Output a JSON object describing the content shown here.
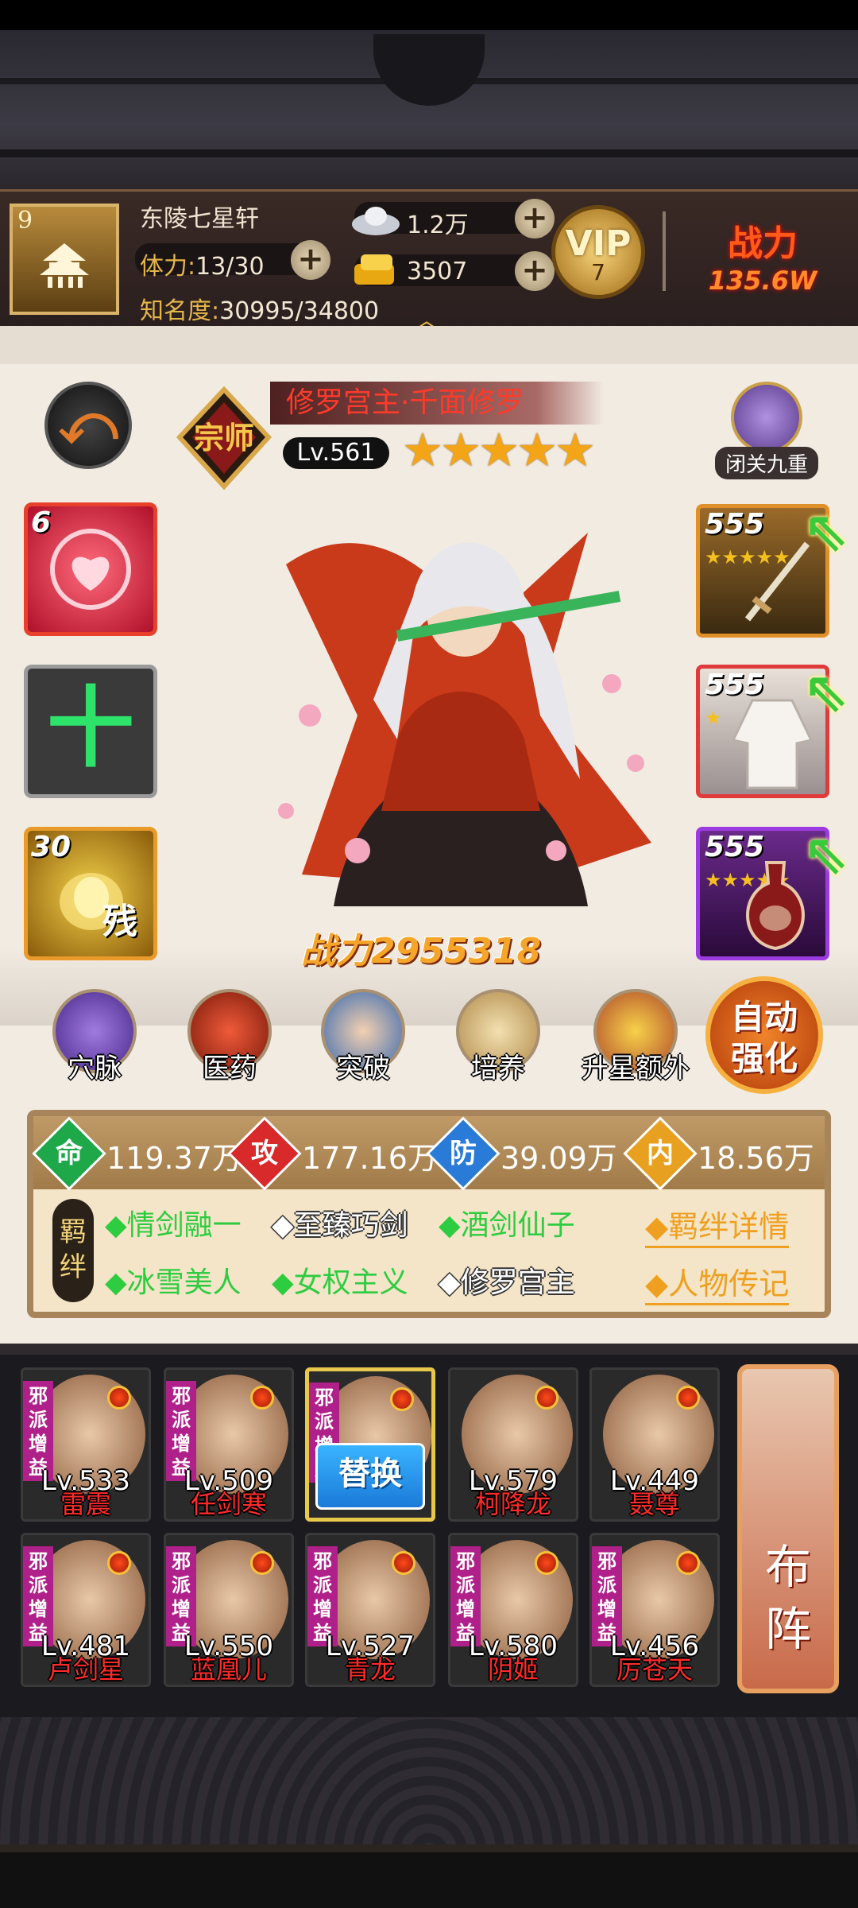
{
  "player": {
    "rank": "9",
    "name": "东陵七星轩",
    "stamina_label": "体力:",
    "stamina_value": "13/30",
    "fame_label": "知名度:",
    "fame_value": "30995/34800",
    "silver": "1.2万",
    "gold": "3507",
    "vip_label": "VIP",
    "vip_level": "7",
    "power_label": "战力",
    "power_value": "135.6W"
  },
  "hero": {
    "badge_text": "宗师",
    "name": "修罗宫主·千面修罗",
    "level": "Lv.561",
    "stars": 5,
    "closed_label": "闭关九重",
    "power_label": "战力",
    "power_value": "2955318"
  },
  "left_slots": [
    {
      "count": "6",
      "icon": "heart-rose-icon"
    },
    {
      "count": "",
      "icon": "plus-icon",
      "symbol": "十"
    },
    {
      "count": "30",
      "icon": "martial-scroll-icon",
      "tag": "残"
    }
  ],
  "equipment": [
    {
      "count": "555",
      "icon": "sword-icon",
      "stars": 5
    },
    {
      "count": "555",
      "icon": "robe-icon",
      "stars": 1
    },
    {
      "count": "555",
      "icon": "wine-vase-icon",
      "stars": 5
    }
  ],
  "functions": [
    {
      "label": "穴脉",
      "icon": "meridian-icon"
    },
    {
      "label": "医药",
      "icon": "medicine-icon"
    },
    {
      "label": "突破",
      "icon": "breakthrough-icon"
    },
    {
      "label": "培养",
      "icon": "cultivate-icon"
    },
    {
      "label": "升星额外",
      "icon": "star-up-icon"
    }
  ],
  "auto_strengthen": "自动强化",
  "stats": [
    {
      "label": "命",
      "value": "119.37万",
      "color": "#1ea84a"
    },
    {
      "label": "攻",
      "value": "177.16万",
      "color": "#d82a2a"
    },
    {
      "label": "防",
      "value": "39.09万",
      "color": "#2a7ad8"
    },
    {
      "label": "内",
      "value": "18.56万",
      "color": "#e8a020"
    }
  ],
  "bond_label": "羁绊",
  "bonds": [
    {
      "text": "◆情剑融一",
      "active": true
    },
    {
      "text": "◆至臻巧剑",
      "active": false
    },
    {
      "text": "◆酒剑仙子",
      "active": true
    },
    {
      "text": "◆冰雪美人",
      "active": true
    },
    {
      "text": "◆女权主义",
      "active": true
    },
    {
      "text": "◆修罗宫主",
      "active": false
    }
  ],
  "bond_detail_link": "◆羁绊详情",
  "biography_link": "◆人物传记",
  "team": [
    {
      "level": "Lv.533",
      "name": "雷震",
      "tag": "邪派增益"
    },
    {
      "level": "Lv.509",
      "name": "任剑寒",
      "tag": "邪派增益"
    },
    {
      "level": "",
      "name": "",
      "tag": "邪派增益",
      "selected": true,
      "action": "替换"
    },
    {
      "level": "Lv.579",
      "name": "柯降龙",
      "tag": ""
    },
    {
      "level": "Lv.449",
      "name": "聂尊",
      "tag": ""
    },
    {
      "level": "Lv.481",
      "name": "卢剑星",
      "tag": "邪派增益"
    },
    {
      "level": "Lv.550",
      "name": "蓝凰儿",
      "tag": "邪派增益"
    },
    {
      "level": "Lv.527",
      "name": "青龙",
      "tag": "邪派增益"
    },
    {
      "level": "Lv.580",
      "name": "阴姬",
      "tag": "邪派增益"
    },
    {
      "level": "Lv.456",
      "name": "厉苍天",
      "tag": "邪派增益"
    }
  ],
  "formation_label": "布阵"
}
